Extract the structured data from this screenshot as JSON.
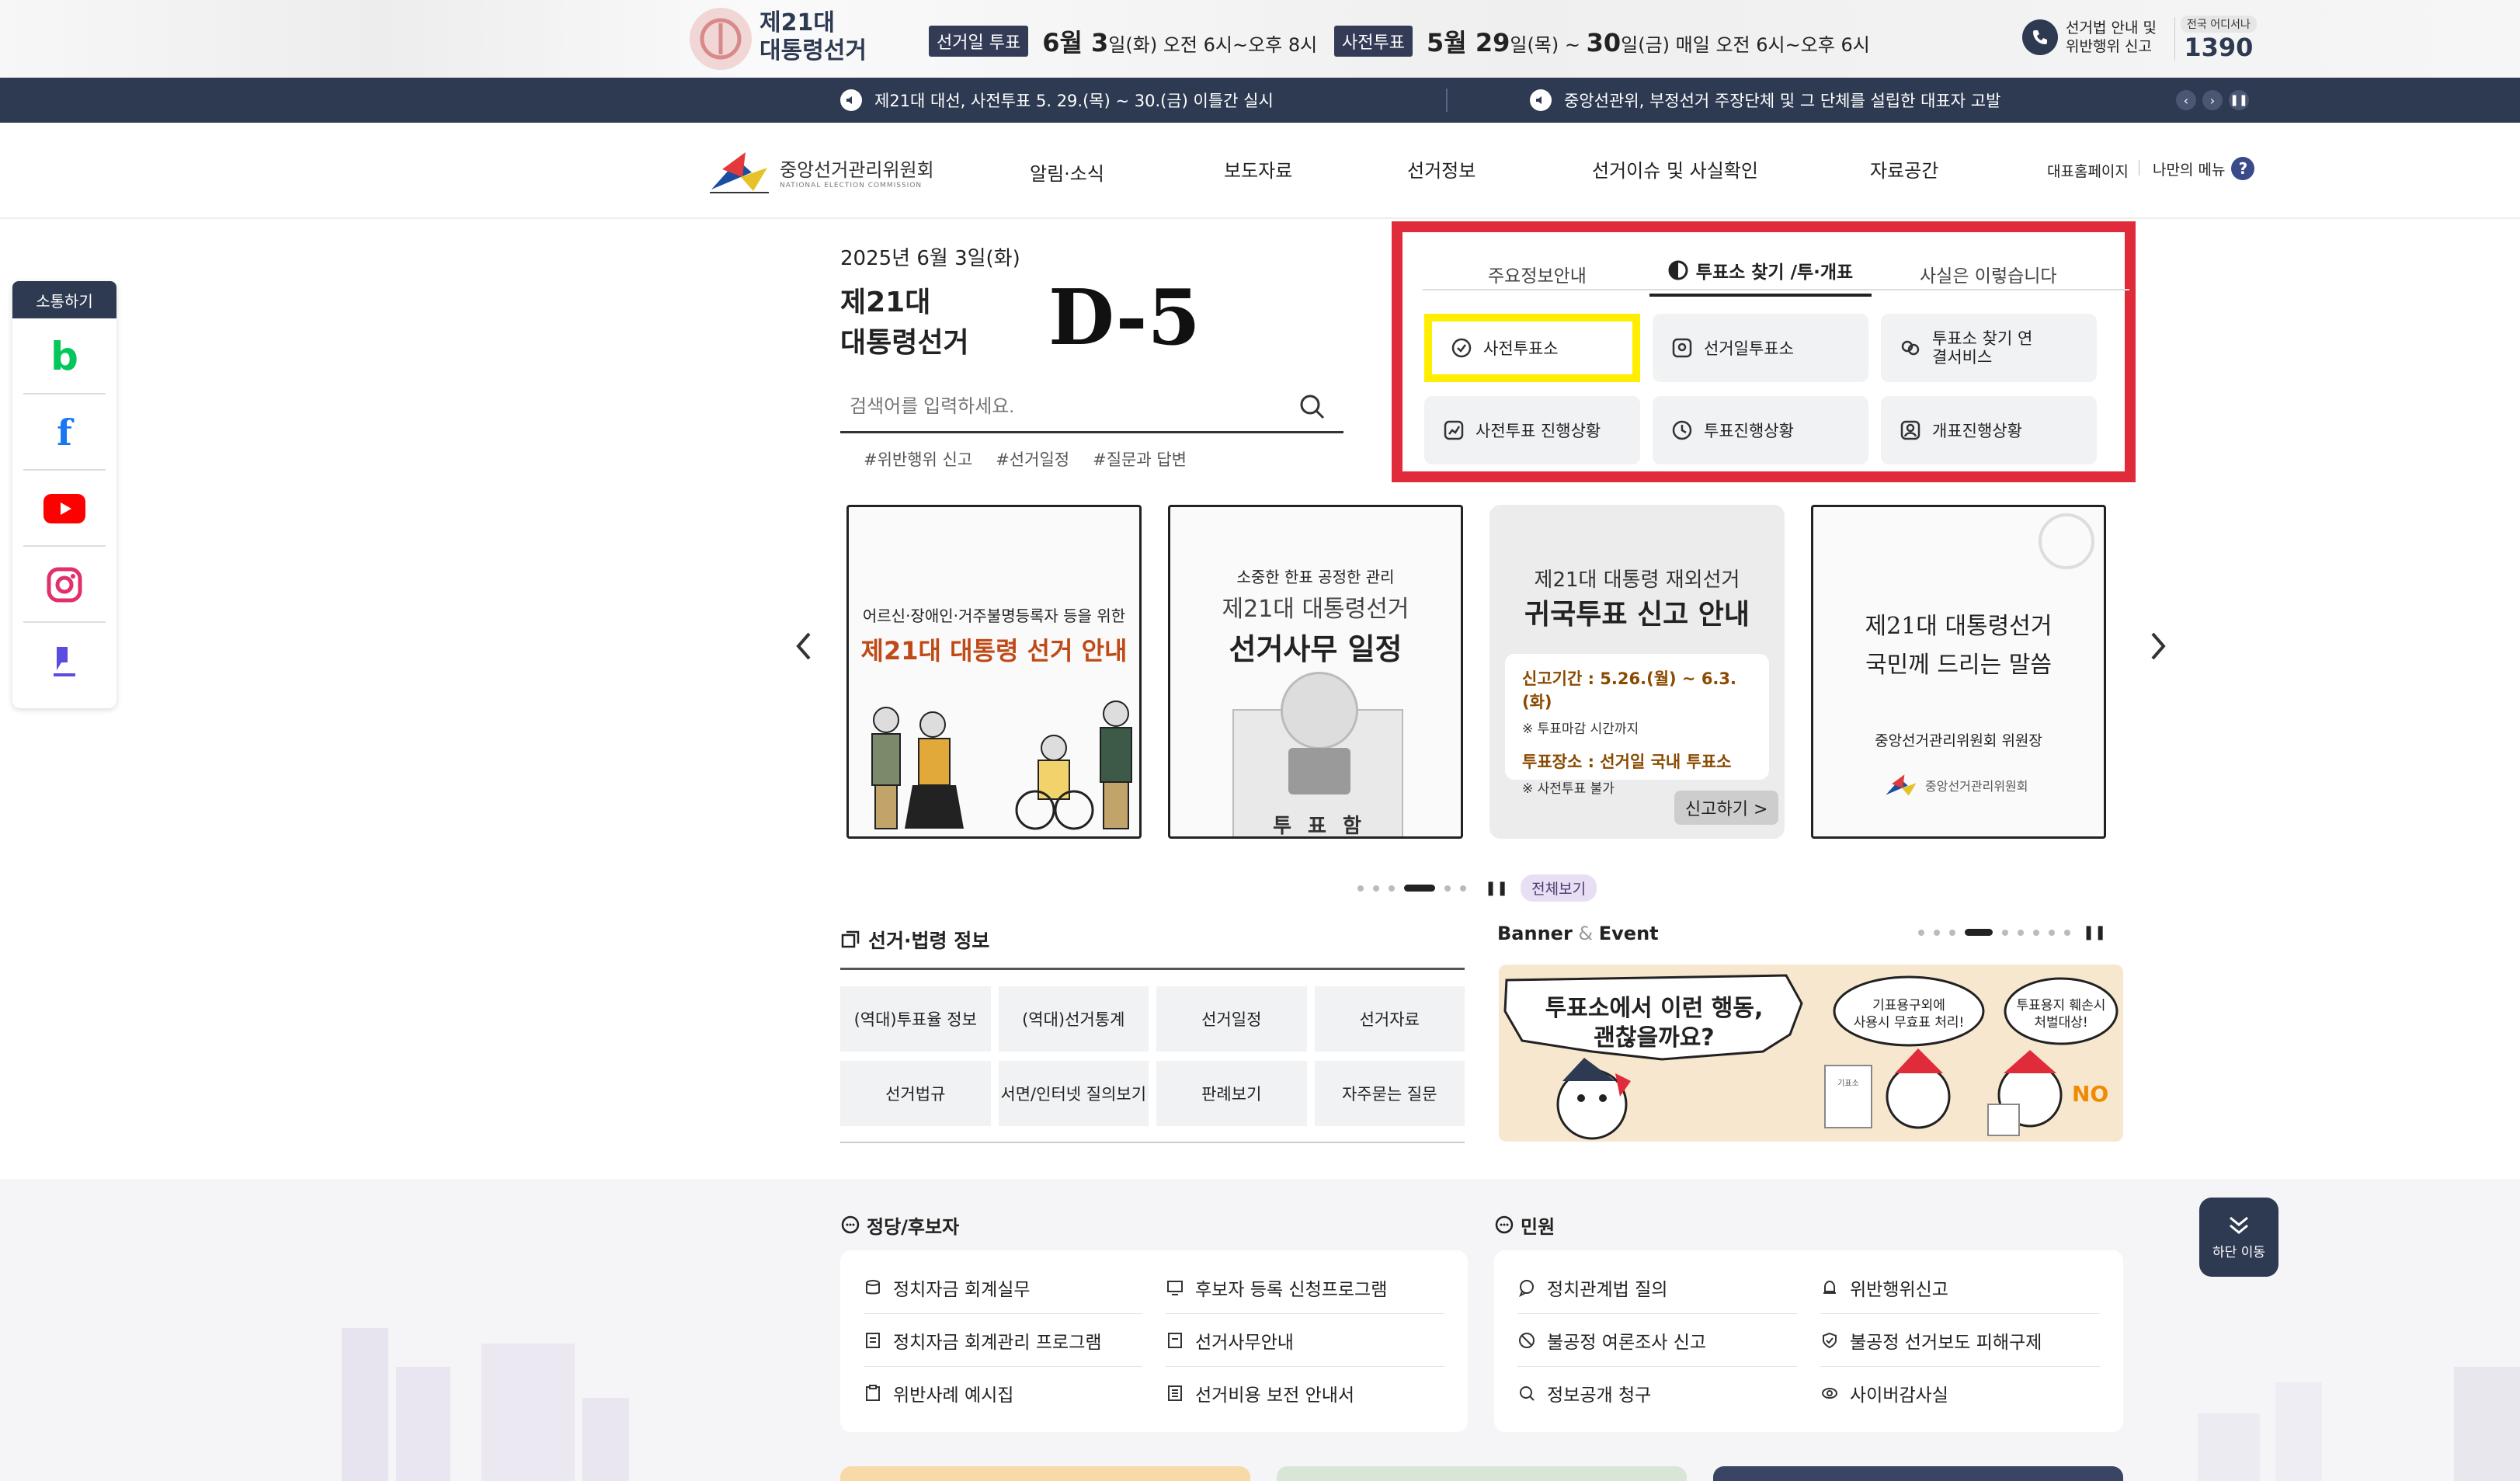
{
  "topbar": {
    "title_line1": "제21대",
    "title_line2": "대통령선거",
    "election_tag": "선거일 투표",
    "election_date_big": "6월 3",
    "election_date_rest": "일(화) 오전 6시~오후 8시",
    "early_tag": "사전투표",
    "early_date_a": "5월 29",
    "early_date_b": "일(목) ~ ",
    "early_date_c": "30",
    "early_date_d": "일(금) 매일 오전 6시~오후 6시",
    "report_line1": "선거법 안내 및",
    "report_line2": "위반행위 신고",
    "hotline_small": "전국 어디서나",
    "hotline": "1390"
  },
  "notice": {
    "item1": "제21대 대선, 사전투표 5. 29.(목) ~ 30.(금) 이틀간 실시",
    "item2": "중앙선관위, 부정선거 주장단체 및 그 단체를 설립한 대표자 고발"
  },
  "header": {
    "logo_kr": "중앙선거관리위원회",
    "logo_en": "NATIONAL ELECTION COMMISSION",
    "nav": [
      "알림·소식",
      "보도자료",
      "선거정보",
      "선거이슈 및 사실확인",
      "자료공간"
    ],
    "util1": "대표홈페이지",
    "util2": "나만의 메뉴"
  },
  "social": {
    "title": "소통하기"
  },
  "hero": {
    "date": "2025년 6월 3일(화)",
    "title_line1": "제21대",
    "title_line2": "대통령선거",
    "dday": "D-5",
    "search_placeholder": "검색어를 입력하세요.",
    "hashtags": [
      "#위반행위 신고",
      "#선거일정",
      "#질문과 답변"
    ]
  },
  "tabs": {
    "items": [
      "주요정보안내",
      "투표소 찾기 /투·개표",
      "사실은 이렇습니다"
    ],
    "active_index": 1,
    "buttons": [
      "사전투표소",
      "선거일투표소",
      "투표소 찾기 연결서비스",
      "사전투표 진행상황",
      "투표진행상황",
      "개표진행상황"
    ]
  },
  "slides": [
    {
      "line1": "어르신·장애인·거주불명등록자 등을 위한",
      "line2": "제21대 대통령 선거 안내"
    },
    {
      "line1": "소중한 한표 공정한 관리",
      "line2": "제21대 대통령선거",
      "line3": "선거사무 일정",
      "box_label": "투 표 함"
    },
    {
      "line1": "제21대 대통령 재외선거",
      "line2": "귀국투표 신고 안내",
      "line3": "신고기간 : 5.26.(월) ~ 6.3.(화)",
      "line4": "※ 투표마감 시간까지",
      "line5": "투표장소 : 선거일 국내 투표소",
      "line6": "※ 사전투표 불가",
      "cta": "신고하기 >"
    },
    {
      "line1": "제21대 대통령선거",
      "line2": "국민께 드리는 말씀",
      "line3": "중앙선거관리위원회 위원장",
      "line4": "중앙선거관리위원회"
    }
  ],
  "carousel": {
    "view_all": "전체보기"
  },
  "election_law": {
    "title": "선거·법령 정보",
    "links": [
      "(역대)투표율 정보",
      "(역대)선거통계",
      "선거일정",
      "선거자료",
      "선거법규",
      "서면/인터넷 질의보기",
      "판례보기",
      "자주묻는 질문"
    ]
  },
  "banner": {
    "title_a": "Banner",
    "title_amp": " & ",
    "title_b": "Event",
    "bubble_main_line1": "투표소에서 이런 행동,",
    "bubble_main_line2": "괜찮을까요?",
    "bubble2_line1": "기표용구외에",
    "bubble2_line2": "사용시 무효표 처리!",
    "bubble3_line1": "투표용지 훼손시",
    "bubble3_line2": "처벌대상!",
    "no_text": "NO",
    "sign_text": "기표소"
  },
  "party": {
    "title": "정당/후보자",
    "items": [
      "정치자금 회계실무",
      "후보자 등록 신청프로그램",
      "정치자금 회계관리 프로그램",
      "선거사무안내",
      "위반사례 예시집",
      "선거비용 보전 안내서"
    ]
  },
  "civil": {
    "title": "민원",
    "items": [
      "정치관계법 질의",
      "위반행위신고",
      "불공정 여론조사 신고",
      "불공정 선거보도 피해구제",
      "정보공개 청구",
      "사이버감사실"
    ]
  },
  "float_btn": {
    "label": "하단 이동"
  },
  "colors": {
    "navy": "#2d3a52",
    "highlight_red": "#e02b3a",
    "highlight_yellow": "#ffee00",
    "youtube": "#ff0000",
    "band": "#03c75a"
  }
}
